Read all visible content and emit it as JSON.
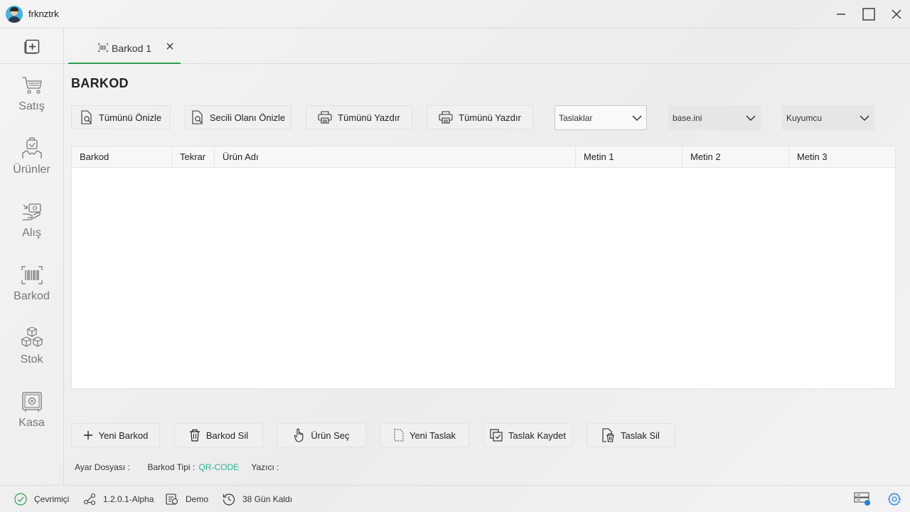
{
  "titlebar": {
    "username": "frknztrk",
    "minimize_icon": "minimize-icon",
    "maximize_icon": "maximize-icon",
    "close_icon": "close-icon"
  },
  "sidebar": {
    "new_icon": "plus-square-icon",
    "items": [
      {
        "label": "Satış",
        "icon": "cart-icon"
      },
      {
        "label": "Ürünler",
        "icon": "products-icon"
      },
      {
        "label": "Alış",
        "icon": "purchase-icon"
      },
      {
        "label": "Barkod",
        "icon": "barcode-icon"
      },
      {
        "label": "Stok",
        "icon": "boxes-icon"
      },
      {
        "label": "Kasa",
        "icon": "safe-icon"
      }
    ]
  },
  "tabs": [
    {
      "label": "Barkod 1",
      "icon": "barcode-icon",
      "active": true
    }
  ],
  "page": {
    "title": "BARKOD"
  },
  "toolbar": {
    "preview_all": "Tümünü Önizle",
    "preview_selected": "Secili Olanı Önizle",
    "print_all_1": "Tümünü Yazdır",
    "print_all_2": "Tümünü Yazdır",
    "drafts_select": "Taslaklar",
    "config_select": "base.ini",
    "template_select": "Kuyumcu"
  },
  "table": {
    "columns": [
      "Barkod",
      "Tekrar",
      "Ürün Adı",
      "Metin 1",
      "Metin 2",
      "Metin 3"
    ],
    "rows": []
  },
  "actions": {
    "new_barcode": "Yeni Barkod",
    "delete_barcode": "Barkod Sil",
    "select_product": "Ürün Seç",
    "new_draft": "Yeni Taslak",
    "save_draft": "Taslak Kaydet",
    "delete_draft": "Taslak Sil"
  },
  "info": {
    "settings_file_label": "Ayar Dosyası :",
    "barcode_type_label": "Barkod Tipi :",
    "barcode_type_value": "QR-CODE",
    "printer_label": "Yazıcı :"
  },
  "statusbar": {
    "online": "Çevrimiçi",
    "version": "1.2.0.1-Alpha",
    "license": "Demo",
    "days_left": "38 Gün Kaldı"
  },
  "colors": {
    "accent_green": "#2e9e4f",
    "link_teal": "#27b39b",
    "settings_blue": "#2a7fd4"
  }
}
